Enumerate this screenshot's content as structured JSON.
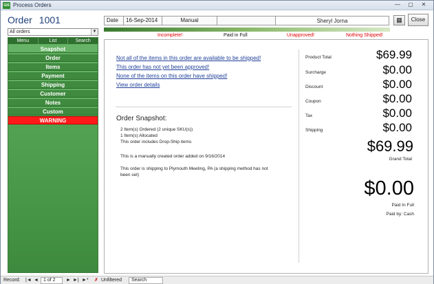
{
  "window": {
    "title": "Process Orders",
    "app_icon": "GIS",
    "minimize": "—",
    "restore": "▢",
    "close": "✕"
  },
  "sidebar": {
    "order_label": "Order",
    "order_number": "1001",
    "filter_value": "All orders",
    "tabs": [
      "Menu",
      "List",
      "Search"
    ],
    "items": [
      "Snapshot",
      "Order",
      "Items",
      "Payment",
      "Shipping",
      "Customer",
      "Notes",
      "Custom",
      "WARNING"
    ]
  },
  "header": {
    "date_label": "Date",
    "date_value": "16-Sep-2014",
    "order_type": "Manual",
    "customer_name": "Sheryl Jorna",
    "calc_icon": "▦",
    "close_button": "Close"
  },
  "status_stages": [
    "Incomplete!",
    "Paid in Full",
    "Unapproved!",
    "Nothing Shipped!"
  ],
  "links": [
    "Not all of the items in this order are available to be shipped!",
    "This order has not yet been approved!",
    "None of the items on this order have shipped!",
    "View order details"
  ],
  "snapshot": {
    "title": "Order Snapshot:",
    "lines": [
      "2 Item(s) Ordered (2 unique SKU(s))",
      "1 Item(s) Allocated",
      "This order includes Drop-Ship items",
      "This is a manually created order added on 9/16/2014",
      "This order is shipping to Plymouth Meeting, PA (a shipping method has not",
      "been set)"
    ]
  },
  "totals": {
    "rows": [
      {
        "label": "Product Total",
        "value": "$69.99"
      },
      {
        "label": "Surcharge",
        "value": "$0.00"
      },
      {
        "label": "Discount",
        "value": "$0.00"
      },
      {
        "label": "Coupon",
        "value": "$0.00"
      },
      {
        "label": "Tax",
        "value": "$0.00"
      },
      {
        "label": "Shipping",
        "value": "$0.00"
      }
    ],
    "grand_total_value": "$69.99",
    "grand_total_label": "Grand Total",
    "paid_value": "$0.00",
    "paid_label": "Paid In Full",
    "paid_by": "Paid by: Cash"
  },
  "record_nav": {
    "label": "Record:",
    "first": "|◄",
    "prev": "◄",
    "position": "1 of 2",
    "next": "►",
    "last": "►|",
    "new": "►*",
    "filter_icon": "✗",
    "filter_status": "Unfiltered",
    "search": "Search"
  },
  "colors": {
    "accent_green": "#4b9a4b",
    "warning_red": "#ff1a1a",
    "link_blue": "#1f3f9a",
    "stage_red": "#e00000"
  }
}
